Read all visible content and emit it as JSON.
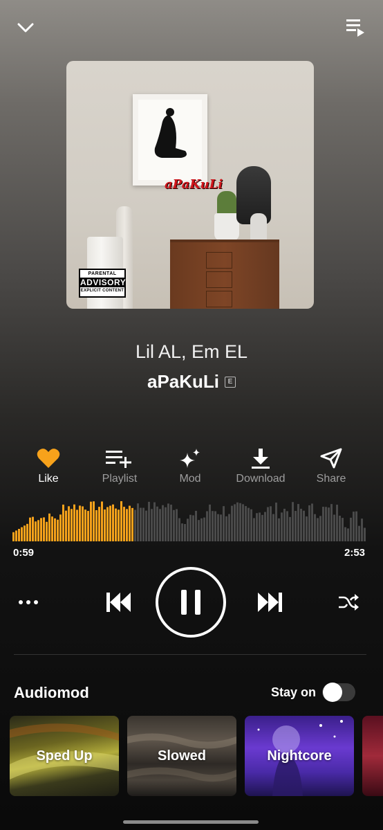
{
  "top_bar": {
    "collapse_icon": "chevron-down-icon",
    "queue_icon": "queue-icon"
  },
  "cover": {
    "art_text": "aPaKuLi",
    "advisory_line1": "PARENTAL",
    "advisory_line2": "ADVISORY",
    "advisory_line3": "EXPLICIT CONTENT"
  },
  "song": {
    "artist": "Lil AL, Em EL",
    "title": "aPaKuLi",
    "explicit_badge": "E"
  },
  "actions": [
    {
      "label": "Like",
      "icon": "heart-icon",
      "active": true
    },
    {
      "label": "Playlist",
      "icon": "playlist-add-icon",
      "active": false
    },
    {
      "label": "Mod",
      "icon": "sparkles-icon",
      "active": false
    },
    {
      "label": "Download",
      "icon": "download-icon",
      "active": false
    },
    {
      "label": "Share",
      "icon": "share-icon",
      "active": false
    }
  ],
  "progress": {
    "elapsed": "0:59",
    "total": "2:53",
    "fraction": 0.34
  },
  "colors": {
    "accent": "#f7a21b",
    "wave_inactive": "#4a4a4a"
  },
  "audiomod": {
    "title": "Audiomod",
    "stay_on_label": "Stay on",
    "stay_on": false,
    "presets": [
      {
        "label": "Sped Up"
      },
      {
        "label": "Slowed"
      },
      {
        "label": "Nightcore"
      }
    ]
  }
}
